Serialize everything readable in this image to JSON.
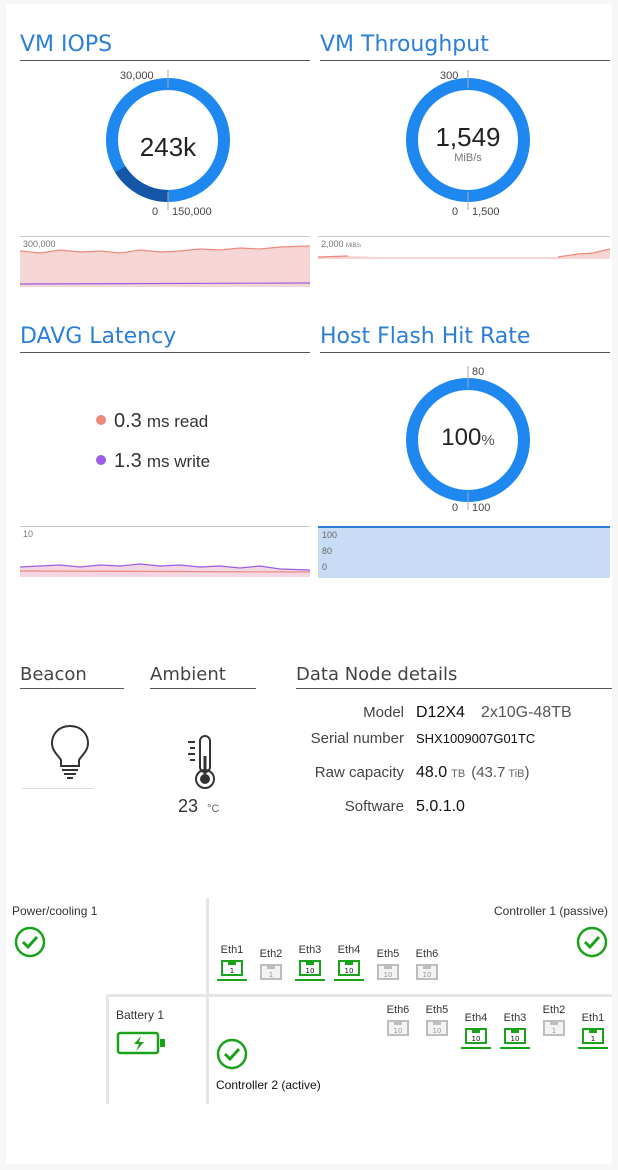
{
  "colors": {
    "accent": "#2b7fd8",
    "gauge": "#1e88f0",
    "gauge_dark": "#1556a8",
    "read": "#ee8a7d",
    "write": "#9b5de5",
    "ok_green": "#1aa31a",
    "port_active": "#1aa31a",
    "port_inactive": "#bdbdbd"
  },
  "iops": {
    "title": "VM IOPS",
    "value": "243k",
    "fraction": 0.162,
    "max_label": "30,000",
    "min_label": "0",
    "end_label": "150,000",
    "chart_label": "300,000"
  },
  "throughput": {
    "title": "VM Throughput",
    "value": "1,549",
    "unit": "MiB/s",
    "fraction": 1.0,
    "max_label": "300",
    "min_label": "0",
    "end_label": "1,500",
    "chart_label": "2,000",
    "chart_unit": "MiB/s"
  },
  "latency": {
    "title": "DAVG Latency",
    "read_value": "0.3",
    "read_unit": "ms read",
    "write_value": "1.3",
    "write_unit": "ms write",
    "chart_label": "10"
  },
  "flash": {
    "title": "Host Flash Hit Rate",
    "value": "100",
    "unit": "%",
    "fraction": 1.0,
    "max_label": "80",
    "min_label": "0",
    "end_label": "100",
    "chart_labels": [
      "100",
      "80",
      "0"
    ]
  },
  "beacon": {
    "title": "Beacon",
    "icon": "lightbulb-icon"
  },
  "ambient": {
    "title": "Ambient",
    "icon": "thermometer-icon",
    "value": "23",
    "unit": "°C"
  },
  "details": {
    "title": "Data Node details",
    "model_label": "Model",
    "model_value": "D12X4",
    "model_extra": "2x10G-48TB",
    "serial_label": "Serial number",
    "serial_value": "SHX1009007G01TC",
    "capacity_label": "Raw capacity",
    "capacity_value": "48.0",
    "capacity_unit": "TB",
    "capacity_extra_open": "(43.7",
    "capacity_extra_unit": "TiB",
    "capacity_extra_close": ")",
    "software_label": "Software",
    "software_value": "5.0.1.0"
  },
  "hardware": {
    "power_label": "Power/cooling 1",
    "battery_label": "Battery 1",
    "controller1_label": "Controller 1 (passive)",
    "controller2_label": "Controller 2 (active)",
    "c1_ports": [
      {
        "name": "Eth1",
        "speed": "1",
        "active": true
      },
      {
        "name": "Eth2",
        "speed": "1",
        "active": false
      },
      {
        "name": "Eth3",
        "speed": "10",
        "active": true
      },
      {
        "name": "Eth4",
        "speed": "10",
        "active": true
      },
      {
        "name": "Eth5",
        "speed": "10",
        "active": false
      },
      {
        "name": "Eth6",
        "speed": "10",
        "active": false
      }
    ],
    "c2_ports": [
      {
        "name": "Eth6",
        "speed": "10",
        "active": false
      },
      {
        "name": "Eth5",
        "speed": "10",
        "active": false
      },
      {
        "name": "Eth4",
        "speed": "10",
        "active": true
      },
      {
        "name": "Eth3",
        "speed": "10",
        "active": true
      },
      {
        "name": "Eth2",
        "speed": "1",
        "active": false
      },
      {
        "name": "Eth1",
        "speed": "1",
        "active": true
      }
    ]
  }
}
